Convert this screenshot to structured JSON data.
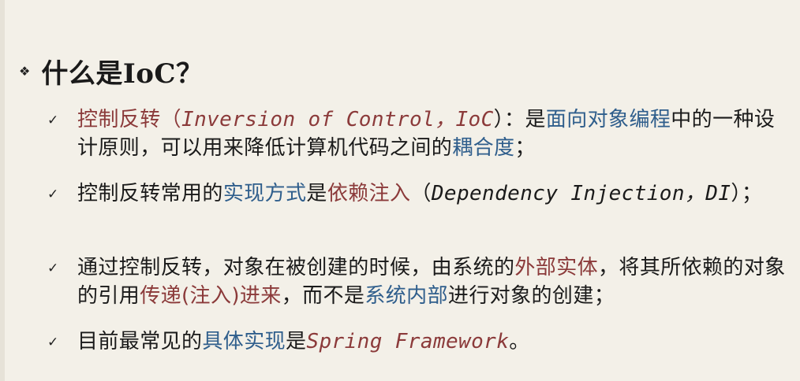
{
  "slide": {
    "title": "什么是IoC？",
    "items": [
      {
        "check_icon": "check-icon",
        "parts": [
          {
            "text": "控制反转（",
            "style": "red"
          },
          {
            "text": "Inversion of Control，IoC",
            "style": "hand-red"
          },
          {
            "text": "）：是",
            "style": "plain"
          },
          {
            "text": "面向对象编程",
            "style": "blue"
          },
          {
            "text": "中的一种设计原则，可以用来降低计算机代码之间的",
            "style": "plain"
          },
          {
            "text": "耦合度",
            "style": "blue"
          },
          {
            "text": "；",
            "style": "plain"
          }
        ]
      },
      {
        "check_icon": "check-icon",
        "parts": [
          {
            "text": "控制反转常用的",
            "style": "plain"
          },
          {
            "text": "实现方式",
            "style": "blue"
          },
          {
            "text": "是",
            "style": "plain"
          },
          {
            "text": "依赖注入",
            "style": "red"
          },
          {
            "text": "（",
            "style": "plain"
          },
          {
            "text": "Dependency Injection，DI",
            "style": "hand"
          },
          {
            "text": "）；",
            "style": "plain"
          }
        ]
      },
      {
        "check_icon": "check-icon",
        "parts": [
          {
            "text": "通过控制反转，对象在被创建的时候，由系统的",
            "style": "plain"
          },
          {
            "text": "外部实体",
            "style": "red"
          },
          {
            "text": "，将其所依赖的对象的引用",
            "style": "plain"
          },
          {
            "text": "传递(注入)进来",
            "style": "red"
          },
          {
            "text": "，而不是",
            "style": "plain"
          },
          {
            "text": "系统内部",
            "style": "blue"
          },
          {
            "text": "进行对象的创建；",
            "style": "plain"
          }
        ]
      },
      {
        "check_icon": "check-icon",
        "parts": [
          {
            "text": "目前最常见的",
            "style": "plain"
          },
          {
            "text": "具体实现",
            "style": "blue"
          },
          {
            "text": "是",
            "style": "plain"
          },
          {
            "text": "Spring Framework",
            "style": "hand-red"
          },
          {
            "text": "。",
            "style": "plain"
          }
        ]
      }
    ]
  }
}
